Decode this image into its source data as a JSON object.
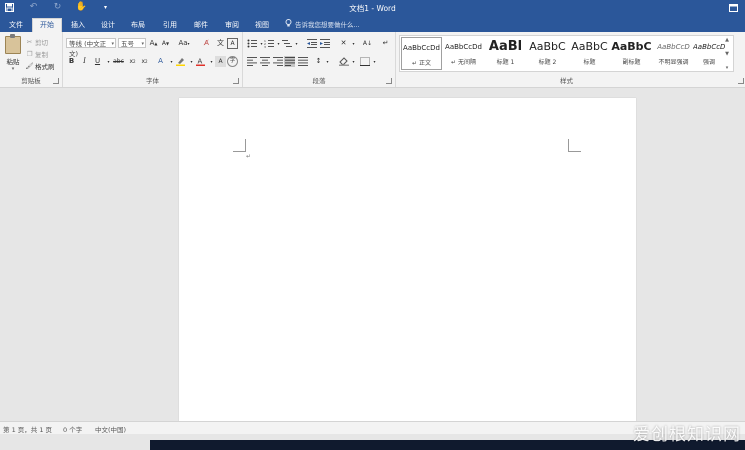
{
  "titlebar": {
    "title": "文档1 - Word"
  },
  "tabs": [
    {
      "label": "文件"
    },
    {
      "label": "开始"
    },
    {
      "label": "插入"
    },
    {
      "label": "设计"
    },
    {
      "label": "布局"
    },
    {
      "label": "引用"
    },
    {
      "label": "邮件"
    },
    {
      "label": "审阅"
    },
    {
      "label": "视图"
    }
  ],
  "tellme": {
    "placeholder": "告诉我您想要做什么..."
  },
  "clipboard": {
    "paste_label": "粘贴",
    "cut_label": "剪切",
    "copy_label": "复制",
    "format_painter_label": "格式刷",
    "group_label": "剪贴板"
  },
  "font": {
    "font_name": "等线 (中文正文)",
    "font_size": "五号",
    "change_case": "Aa",
    "group_label": "字体"
  },
  "paragraph": {
    "group_label": "段落"
  },
  "styles": {
    "group_label": "样式",
    "items": [
      {
        "preview": "AaBbCcDd",
        "name": "↵ 正文"
      },
      {
        "preview": "AaBbCcDd",
        "name": "↵ 无间隔"
      },
      {
        "preview": "AaBl",
        "name": "标题 1"
      },
      {
        "preview": "AaBbC",
        "name": "标题 2"
      },
      {
        "preview": "AaBbC",
        "name": "标题"
      },
      {
        "preview": "AaBbC",
        "name": "副标题"
      },
      {
        "preview": "AaBbCcD",
        "name": "不明显强调"
      },
      {
        "preview": "AaBbCcD",
        "name": "强调"
      }
    ]
  },
  "status": {
    "page": "第 1 页，共 1 页",
    "words": "0 个字",
    "language": "中文(中国)"
  },
  "watermark": "爱创根知识网"
}
